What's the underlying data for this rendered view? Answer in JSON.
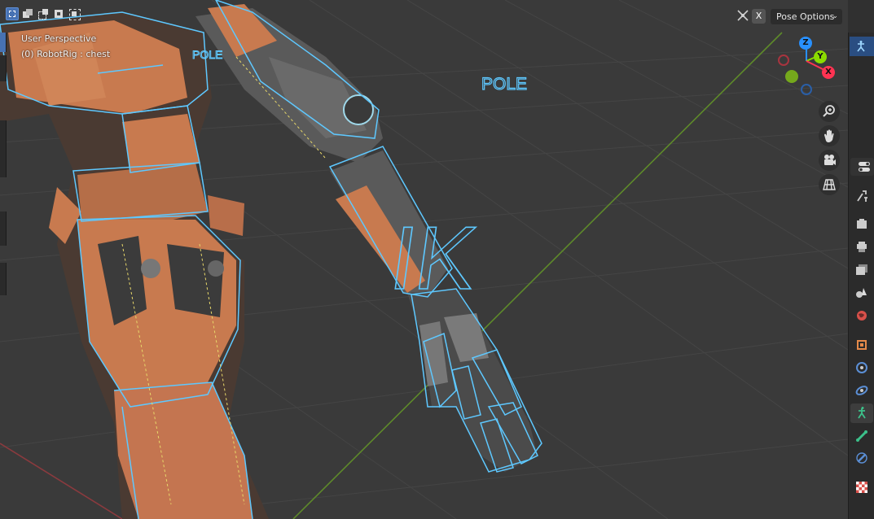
{
  "viewport": {
    "perspective_label": "User Perspective",
    "object_label": "(0) RobotRig : chest",
    "scene_labels": {
      "pole_small": "POLE",
      "pole_large": "POLE",
      "ik": "IK"
    }
  },
  "header": {
    "x_chip_label": "X",
    "pose_options_label": "Pose Options",
    "select_modes": [
      "select-new",
      "select-extend",
      "select-subtract",
      "select-invert",
      "select-intersect"
    ]
  },
  "gizmo": {
    "z": "Z",
    "y": "Y",
    "x": "X"
  },
  "nav_tools": [
    "zoom-icon",
    "hand-pan-icon",
    "camera-icon",
    "grid-ortho-icon"
  ],
  "properties_tabs": [
    "tool",
    "render",
    "output",
    "view-layer",
    "scene",
    "world",
    "object",
    "modifiers",
    "physics",
    "object-data-armature",
    "bone",
    "bone-constraints",
    "texture"
  ],
  "colors": {
    "viewport_bg": "#3a3a3a",
    "bone_outline": "#5ec8ff",
    "robot_orange": "#c87a4f",
    "robot_dark": "#3b3b3b",
    "accent_blue": "#4772b3",
    "axis_x": "#ff3352",
    "axis_y": "#8bdc00",
    "axis_z": "#2890ff"
  }
}
